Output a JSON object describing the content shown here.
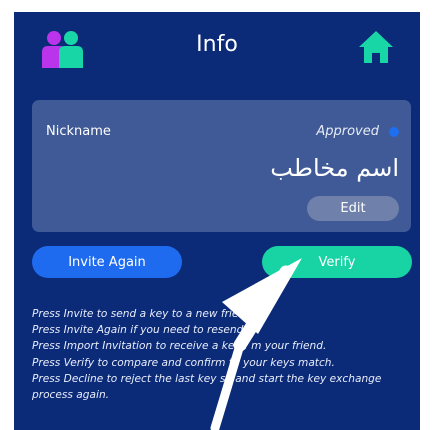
{
  "header": {
    "title": "Info",
    "left_icon": "users-icon",
    "right_icon": "home-icon"
  },
  "card": {
    "nickname_label": "Nickname",
    "status_text": "Approved",
    "status_color": "#1e6ef0",
    "contact_name": "اسم مخاطب",
    "edit_label": "Edit"
  },
  "actions": {
    "invite_again_label": "Invite Again",
    "verify_label": "Verify"
  },
  "instructions": [
    "Press Invite to send a key to a new frie",
    "Press Invite Again if you need to resend a",
    "Press Import Invitation to receive a key f  m your friend.",
    "Press Verify to compare and confirm th   your keys match.",
    "Press Decline to reject the last key se    and start the key exchange",
    "process again."
  ],
  "colors": {
    "background": "#0b2a78",
    "card": "#3f5a96",
    "invite_button": "#1f6bf0",
    "verify_button": "#18d4a4",
    "edit_button": "#6f81ab",
    "home_icon": "#19d6a6"
  }
}
